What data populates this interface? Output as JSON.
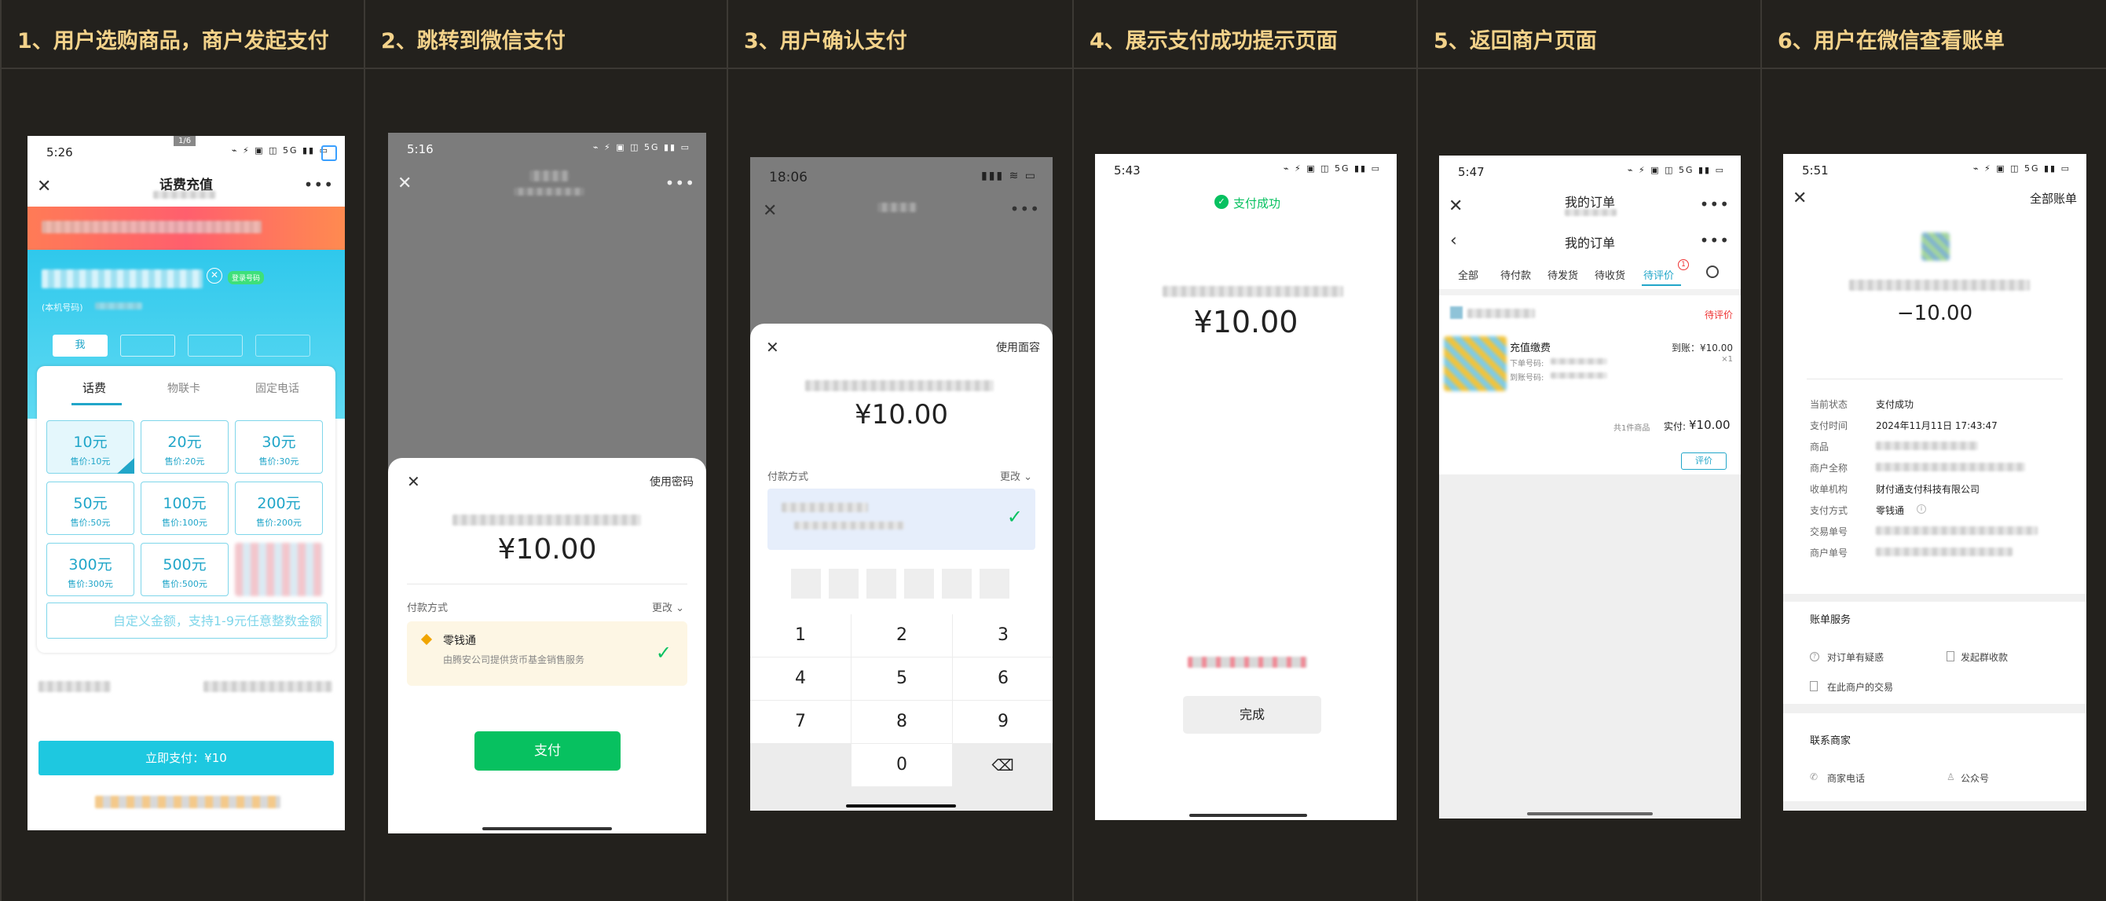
{
  "steps": [
    {
      "title": "1、用户选购商品，商户发起支付"
    },
    {
      "title": "2、跳转到微信支付"
    },
    {
      "title": "3、用户确认支付"
    },
    {
      "title": "4、展示支付成功提示页面"
    },
    {
      "title": "5、返回商户页面"
    },
    {
      "title": "6、用户在微信查看账单"
    }
  ],
  "colors": {
    "bg": "#23211d",
    "heading": "#f3d28a",
    "wechat_green": "#07c160",
    "cyan": "#1ec8e0"
  },
  "p1": {
    "time": "5:26",
    "status_icons": "⌁ ⚡ ▣ ◫ 5G ▮▮ ▭",
    "page_indicator": "1/6",
    "title": "话费充值",
    "badge": "登录号码",
    "local_label": "(本机号码)",
    "me_tab": "我",
    "tabs": [
      "话费",
      "物联卡",
      "固定电话"
    ],
    "tiles": [
      {
        "amount": "10元",
        "price": "售价:10元"
      },
      {
        "amount": "20元",
        "price": "售价:20元"
      },
      {
        "amount": "30元",
        "price": "售价:30元"
      },
      {
        "amount": "50元",
        "price": "售价:50元"
      },
      {
        "amount": "100元",
        "price": "售价:100元"
      },
      {
        "amount": "200元",
        "price": "售价:200元"
      },
      {
        "amount": "300元",
        "price": "售价:300元"
      },
      {
        "amount": "500元",
        "price": "售价:500元"
      }
    ],
    "custom_placeholder": "自定义金额，支持1-9元任意整数金额",
    "pay_button": "立即支付：¥10"
  },
  "p2": {
    "time": "5:16",
    "use_password": "使用密码",
    "amount": "¥10.00",
    "pay_method_label": "付款方式",
    "change": "更改",
    "method_name": "零钱通",
    "method_desc": "由腾安公司提供货币基金销售服务",
    "pay_button": "支付"
  },
  "p3": {
    "time": "18:06",
    "use_face": "使用面容",
    "amount": "¥10.00",
    "pay_method_label": "付款方式",
    "change": "更改",
    "keys": [
      "1",
      "2",
      "3",
      "4",
      "5",
      "6",
      "7",
      "8",
      "9",
      "0"
    ]
  },
  "p4": {
    "time": "5:43",
    "success": "支付成功",
    "amount": "¥10.00",
    "done": "完成"
  },
  "p5": {
    "time": "5:47",
    "title": "我的订单",
    "subtitle": "我的订单",
    "tabs": [
      "全部",
      "待付款",
      "待发货",
      "待收货",
      "待评价"
    ],
    "badge": "1",
    "status": "待评价",
    "product": "充值缴费",
    "recv": "到账：¥10.00",
    "qty": "×1",
    "order_no_label": "下单号码:",
    "recv_no_label": "到账号码:",
    "item_count": "共1件商品",
    "paid_label": "实付:",
    "paid_amount": "¥10.00",
    "review": "评价"
  },
  "p6": {
    "time": "5:51",
    "all_bills": "全部账单",
    "amount": "−10.00",
    "rows": [
      {
        "label": "当前状态",
        "value": "支付成功"
      },
      {
        "label": "支付时间",
        "value": "2024年11月11日 17:43:47"
      },
      {
        "label": "商品",
        "value": ""
      },
      {
        "label": "商户全称",
        "value": ""
      },
      {
        "label": "收单机构",
        "value": "财付通支付科技有限公司"
      },
      {
        "label": "支付方式",
        "value": "零钱通"
      },
      {
        "label": "交易单号",
        "value": ""
      },
      {
        "label": "商户单号",
        "value": ""
      }
    ],
    "bill_service": "账单服务",
    "doubt": "对订单有疑惑",
    "group": "发起群收款",
    "merchant_trades": "在此商户的交易",
    "contact": "联系商家",
    "phone": "商家电话",
    "official": "公众号"
  }
}
